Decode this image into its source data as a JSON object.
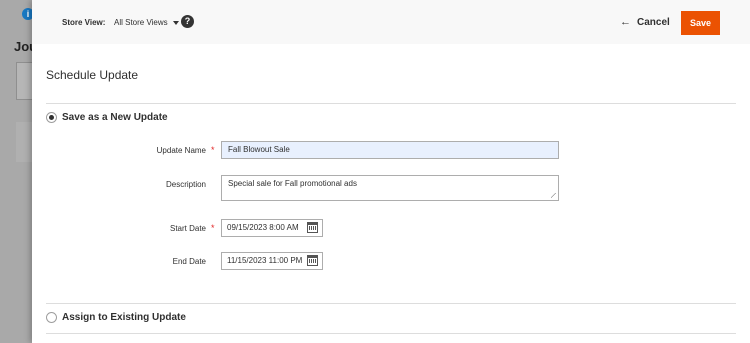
{
  "background": {
    "heading": "Jou"
  },
  "toolbar": {
    "store_view_label": "Store View:",
    "store_view_value": "All Store Views",
    "help_glyph": "?",
    "cancel_label": "Cancel",
    "save_label": "Save"
  },
  "modal": {
    "title": "Schedule Update"
  },
  "options": {
    "new_update_label": "Save as a New Update",
    "existing_update_label": "Assign to Existing Update",
    "selected": "new_update"
  },
  "form": {
    "update_name": {
      "label": "Update Name",
      "value": "Fall Blowout Sale",
      "required": true
    },
    "description": {
      "label": "Description",
      "value": "Special sale for Fall promotional ads"
    },
    "start_date": {
      "label": "Start Date",
      "value": "09/15/2023 8:00 AM",
      "required": true
    },
    "end_date": {
      "label": "End Date",
      "value": "11/15/2023 11:00 PM"
    }
  },
  "colors": {
    "save_button": "#eb5202",
    "required_marker": "#e22626",
    "autofill_background": "#e8f0fe"
  },
  "icons": {
    "help": "help-icon",
    "cancel": "arrow-left-icon",
    "calendar": "calendar-icon",
    "info": "info-icon"
  }
}
